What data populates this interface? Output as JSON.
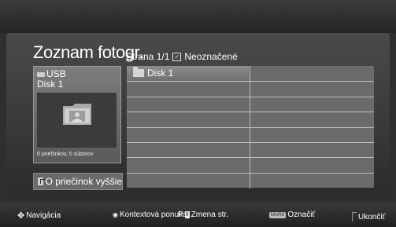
{
  "header": {
    "title": "Zoznam fotogr.",
    "page_label": "Strana 1/1",
    "selection_label": "Neoznačené"
  },
  "device": {
    "name": "USB",
    "disk": "Disk 1",
    "stats": "0 priečinkov, 0 súborov"
  },
  "up_folder": {
    "label": "O priečinok vyššie"
  },
  "list": {
    "items": [
      {
        "label": "Disk 1",
        "icon": "folder-icon",
        "selected": true
      }
    ],
    "rows": 8,
    "columns": 2
  },
  "footer": {
    "hints": [
      {
        "icon": "navigation-arrows-icon",
        "label": "Navigácia"
      },
      {
        "icon": "ok-button-icon",
        "label": "Kontextová ponuka"
      },
      {
        "icon": "page-button-icon",
        "label": "Zmena str."
      },
      {
        "icon": "mark-button-icon",
        "label": "Označiť"
      },
      {
        "icon": "exit-button-icon",
        "label": "Ukončiť"
      }
    ]
  },
  "colors": {
    "background": "#2f2f2f",
    "panel": "#4a4a4a",
    "list": "#6b6b6b",
    "selected_cell": "#8d8d8d",
    "text": "#ffffff"
  }
}
